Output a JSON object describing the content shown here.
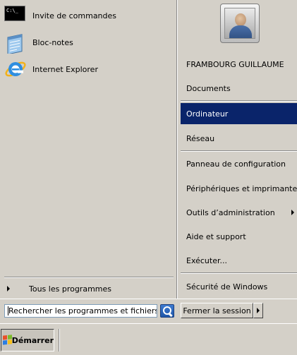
{
  "left_pane": {
    "programs": [
      {
        "label": "Invite de commandes",
        "icon": "command-prompt-icon"
      },
      {
        "label": "Bloc-notes",
        "icon": "notepad-icon"
      },
      {
        "label": "Internet Explorer",
        "icon": "internet-explorer-icon"
      }
    ],
    "cmd_icon_text": "C:\\_",
    "all_programs_label": "Tous les programmes"
  },
  "right_pane": {
    "user_name": "FRAMBOURG GUILLAUME",
    "items": [
      {
        "label": "Documents"
      },
      {
        "label": "Ordinateur",
        "selected": true
      },
      {
        "label": "Réseau"
      },
      {
        "label": "Panneau de configuration"
      },
      {
        "label": "Périphériques et imprimantes"
      },
      {
        "label": "Outils d’administration",
        "has_submenu": true
      },
      {
        "label": "Aide et support"
      },
      {
        "label": "Exécuter..."
      },
      {
        "label": "Sécurité de Windows"
      }
    ]
  },
  "search": {
    "value": "Rechercher les programmes et fichiers"
  },
  "shutdown": {
    "label": "Fermer la session"
  },
  "taskbar": {
    "start_label": "Démarrer"
  },
  "colors": {
    "selection": "#0a246a",
    "face": "#d4d0c8"
  }
}
